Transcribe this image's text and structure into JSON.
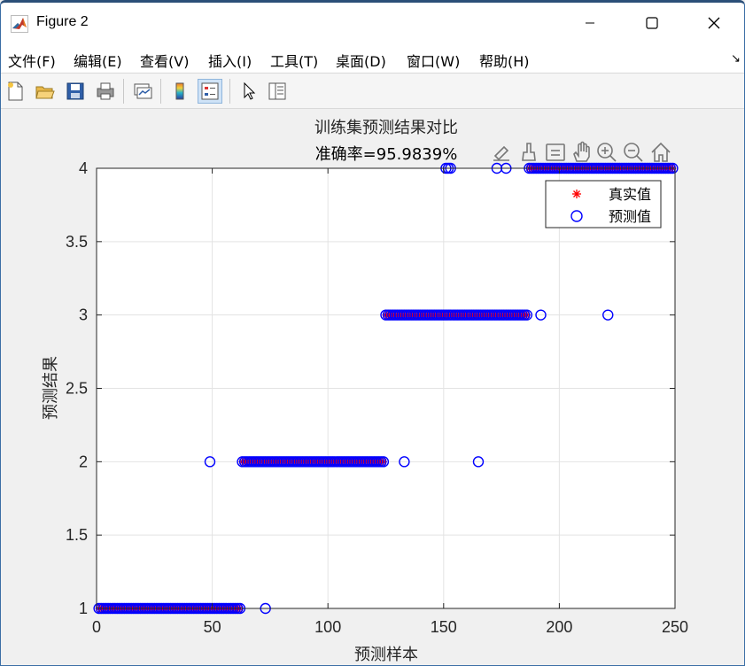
{
  "window": {
    "title": "Figure 2",
    "min_glyph": "—",
    "close_glyph": "✕"
  },
  "menu": {
    "items": [
      "文件(F)",
      "编辑(E)",
      "查看(V)",
      "插入(I)",
      "工具(T)",
      "桌面(D)",
      "窗口(W)",
      "帮助(H)"
    ],
    "underline_letters": [
      "F",
      "E",
      "V",
      "I",
      "T",
      "D",
      "W",
      "H"
    ],
    "dock_glyph": "↘"
  },
  "toolbar": {
    "tools": [
      "new-figure-icon",
      "open-file-icon",
      "save-icon",
      "print-icon",
      "link-plot-icon",
      "colorbar-icon",
      "legend-icon",
      "edit-plot-icon",
      "property-inspector-icon"
    ]
  },
  "axes_toolbar": {
    "tools": [
      "brush-export-icon",
      "data-brush-icon",
      "data-tips-icon",
      "pan-hand-icon",
      "zoom-in-icon",
      "zoom-out-icon",
      "home-restore-icon"
    ]
  },
  "colors": {
    "true_marker": "#ff0000",
    "pred_marker": "#0000ff",
    "grid": "#e3e3e3",
    "axis": "#262626"
  },
  "chart_data": {
    "type": "scatter",
    "title": "训练集预测结果对比",
    "subtitle": "准确率=95.9839%",
    "xlabel": "预测样本",
    "ylabel": "预测结果",
    "xlim": [
      0,
      250
    ],
    "ylim": [
      1,
      4
    ],
    "xticks": [
      0,
      50,
      100,
      150,
      200,
      250
    ],
    "yticks": [
      1,
      1.5,
      2,
      2.5,
      3,
      3.5,
      4
    ],
    "xtick_labels": [
      "0",
      "50",
      "100",
      "150",
      "200",
      "250"
    ],
    "ytick_labels": [
      "1",
      "1.5",
      "2",
      "2.5",
      "3",
      "3.5",
      "4"
    ],
    "grid": true,
    "legend_position": "top-right",
    "series": [
      {
        "name": "真实值",
        "marker": "asterisk",
        "segments": [
          {
            "x_start": 1,
            "x_end": 62,
            "y": 1
          },
          {
            "x_start": 63,
            "x_end": 124,
            "y": 2
          },
          {
            "x_start": 125,
            "x_end": 186,
            "y": 3
          },
          {
            "x_start": 187,
            "x_end": 249,
            "y": 4
          }
        ]
      },
      {
        "name": "预测值",
        "marker": "circle",
        "segments": [
          {
            "x_start": 1,
            "x_end": 62,
            "y": 1
          },
          {
            "x_start": 63,
            "x_end": 124,
            "y": 2
          },
          {
            "x_start": 125,
            "x_end": 186,
            "y": 3
          },
          {
            "x_start": 187,
            "x_end": 249,
            "y": 4
          }
        ],
        "outliers": [
          {
            "x": 49,
            "y": 2
          },
          {
            "x": 73,
            "y": 1
          },
          {
            "x": 133,
            "y": 2
          },
          {
            "x": 151,
            "y": 4
          },
          {
            "x": 152,
            "y": 4
          },
          {
            "x": 153,
            "y": 4
          },
          {
            "x": 165,
            "y": 2
          },
          {
            "x": 173,
            "y": 4
          },
          {
            "x": 177,
            "y": 4
          },
          {
            "x": 192,
            "y": 3
          },
          {
            "x": 221,
            "y": 3
          }
        ]
      }
    ]
  }
}
